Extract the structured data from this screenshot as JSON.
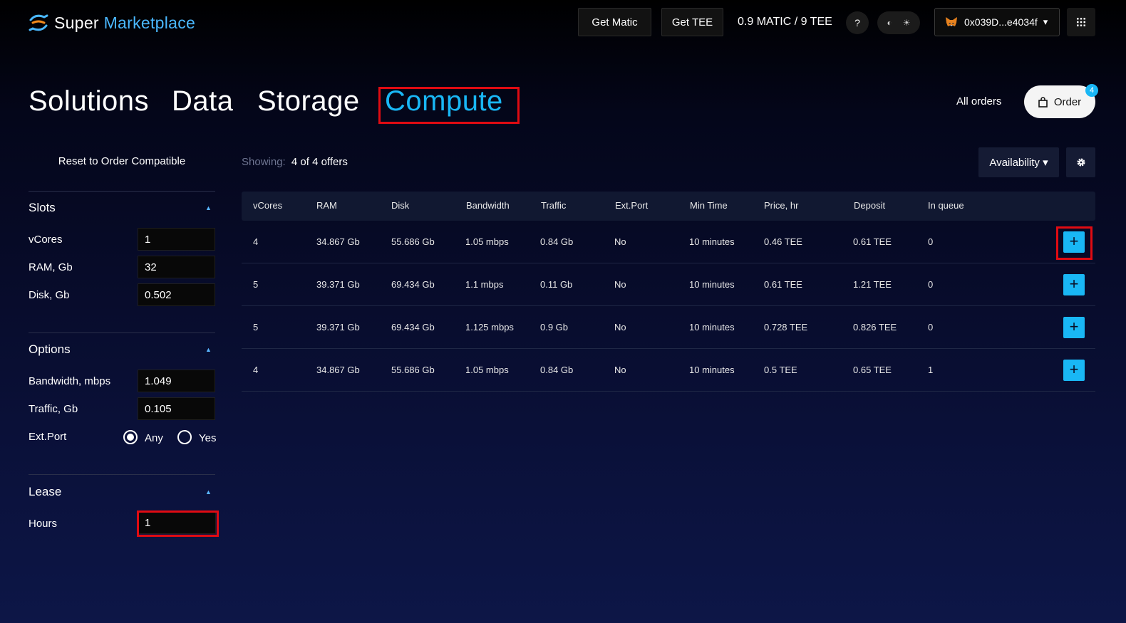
{
  "header": {
    "logo": {
      "word1": "Super",
      "word2": "Marketplace"
    },
    "get_matic_label": "Get Matic",
    "get_tee_label": "Get TEE",
    "balance": "0.9 MATIC / 9 TEE",
    "help_label": "?",
    "wallet_address": "0x039D...e4034f",
    "wallet_caret": "▾"
  },
  "tabs": [
    {
      "label": "Solutions",
      "active": false
    },
    {
      "label": "Data",
      "active": false
    },
    {
      "label": "Storage",
      "active": false
    },
    {
      "label": "Compute",
      "active": true
    }
  ],
  "orders": {
    "all_orders_label": "All orders",
    "order_label": "Order",
    "badge_count": "4"
  },
  "sidebar": {
    "reset_label": "Reset to Order Compatible",
    "slots": {
      "title": "Slots",
      "fields": [
        {
          "label": "vCores",
          "value": "1"
        },
        {
          "label": "RAM, Gb",
          "value": "32"
        },
        {
          "label": "Disk, Gb",
          "value": "0.502"
        }
      ]
    },
    "options": {
      "title": "Options",
      "fields": [
        {
          "label": "Bandwidth, mbps",
          "value": "1.049"
        },
        {
          "label": "Traffic, Gb",
          "value": "0.105"
        }
      ],
      "ext_port": {
        "label": "Ext.Port",
        "options": [
          {
            "label": "Any",
            "checked": true
          },
          {
            "label": "Yes",
            "checked": false
          }
        ]
      }
    },
    "lease": {
      "title": "Lease",
      "hours_label": "Hours",
      "hours_value": "1"
    }
  },
  "main": {
    "showing_label": "Showing:",
    "showing_value": "4 of 4 offers",
    "availability_label": "Availability ▾",
    "columns": [
      "vCores",
      "RAM",
      "Disk",
      "Bandwidth",
      "Traffic",
      "Ext.Port",
      "Min Time",
      "Price, hr",
      "Deposit",
      "In queue"
    ],
    "rows": [
      [
        "4",
        "34.867 Gb",
        "55.686 Gb",
        "1.05 mbps",
        "0.84 Gb",
        "No",
        "10 minutes",
        "0.46 TEE",
        "0.61 TEE",
        "0"
      ],
      [
        "5",
        "39.371 Gb",
        "69.434 Gb",
        "1.1 mbps",
        "0.11 Gb",
        "No",
        "10 minutes",
        "0.61 TEE",
        "1.21 TEE",
        "0"
      ],
      [
        "5",
        "39.371 Gb",
        "69.434 Gb",
        "1.125 mbps",
        "0.9 Gb",
        "No",
        "10 minutes",
        "0.728 TEE",
        "0.826 TEE",
        "0"
      ],
      [
        "4",
        "34.867 Gb",
        "55.686 Gb",
        "1.05 mbps",
        "0.84 Gb",
        "No",
        "10 minutes",
        "0.5 TEE",
        "0.65 TEE",
        "1"
      ]
    ],
    "add_label": "+"
  },
  "colors": {
    "accent": "#19b7f5",
    "highlight": "#e00b12",
    "logo_blue": "#4ab8ff"
  },
  "icons": [
    "logo-icon",
    "question-icon",
    "moon-icon",
    "sun-icon",
    "metamask-fox-icon",
    "grid-menu-icon",
    "shopping-bag-icon",
    "gear-icon",
    "plus-icon",
    "chevron-up-icon",
    "chevron-down-icon"
  ]
}
